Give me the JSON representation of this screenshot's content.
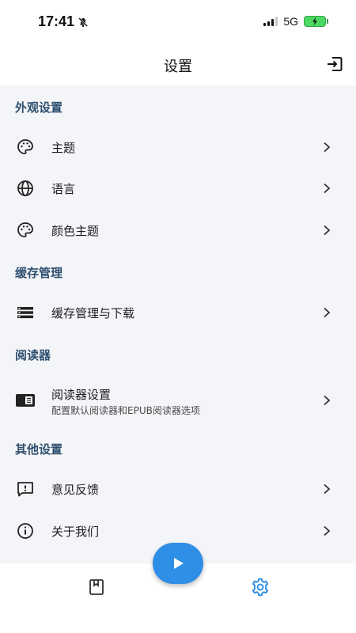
{
  "status_bar": {
    "time": "17:41",
    "network": "5G"
  },
  "app_bar": {
    "title": "设置"
  },
  "sections": {
    "appearance": {
      "header": "外观设置",
      "theme": "主题",
      "language": "语言",
      "color_theme": "颜色主题"
    },
    "cache": {
      "header": "缓存管理",
      "cache_download": "缓存管理与下载"
    },
    "reader": {
      "header": "阅读器",
      "reader_settings": "阅读器设置",
      "reader_settings_desc": "配置默认阅读器和EPUB阅读器选项"
    },
    "other": {
      "header": "其他设置",
      "feedback": "意见反馈",
      "about": "关于我们"
    }
  },
  "icons": {
    "theme": "palette-icon",
    "language": "globe-icon",
    "color_theme": "palette-icon",
    "cache": "storage-list-icon",
    "reader": "reader-icon",
    "feedback": "feedback-icon",
    "about": "info-icon",
    "logout": "logout-icon",
    "nav_library": "book-icon",
    "nav_settings": "gear-icon",
    "fab": "play-icon"
  },
  "colors": {
    "accent": "#2f8ee5",
    "section_header": "#2f4f6e",
    "background": "#f4f5f8"
  },
  "bottom_nav": {
    "active": "settings"
  }
}
